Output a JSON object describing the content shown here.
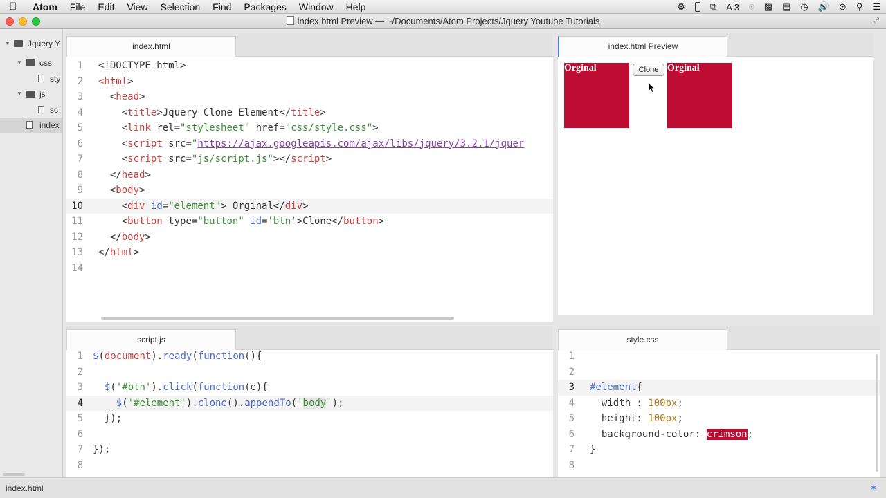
{
  "menubar": {
    "app": "Atom",
    "items": [
      "File",
      "Edit",
      "View",
      "Selection",
      "Find",
      "Packages",
      "Window",
      "Help"
    ],
    "status_icons": [
      "gear-icon",
      "battery-icon",
      "display-icon",
      "adobe-icon",
      "lock-icon",
      "video-icon",
      "toolbox-icon",
      "time-machine-icon",
      "volume-icon",
      "do-not-disturb-icon",
      "spotlight-search-icon",
      "list-icon"
    ],
    "adobe_count": "3"
  },
  "window": {
    "title": "index.html Preview — ~/Documents/Atom Projects/Jquery Youtube Tutorials"
  },
  "tree": {
    "root": "Jquery Y",
    "items": [
      {
        "label": "css",
        "type": "folder"
      },
      {
        "label": "sty",
        "type": "file"
      },
      {
        "label": "js",
        "type": "folder"
      },
      {
        "label": "sc",
        "type": "file"
      },
      {
        "label": "index",
        "type": "file"
      }
    ]
  },
  "editor_html": {
    "tab": "index.html",
    "current_line": 10,
    "lines": [
      {
        "n": "1",
        "indent": "",
        "parts": [
          [
            "",
            "<!DOCTYPE html>"
          ]
        ]
      },
      {
        "n": "2",
        "indent": "",
        "parts": [
          [
            "t",
            "<html"
          ],
          [
            "",
            ">"
          ]
        ]
      },
      {
        "n": "3",
        "indent": "  ",
        "parts": [
          [
            "",
            "<"
          ],
          [
            "t",
            "head"
          ],
          [
            "",
            ">"
          ]
        ]
      },
      {
        "n": "4",
        "indent": "    ",
        "parts": [
          [
            "",
            "<"
          ],
          [
            "t",
            "title"
          ],
          [
            "",
            ">Jquery Clone Element</"
          ],
          [
            "t",
            "title"
          ],
          [
            "",
            ">"
          ]
        ]
      },
      {
        "n": "5",
        "indent": "    ",
        "parts": [
          [
            "",
            "<"
          ],
          [
            "t",
            "link"
          ],
          [
            "",
            " "
          ],
          [
            "",
            "rel="
          ],
          [
            "s",
            "\"stylesheet\""
          ],
          [
            "",
            " href="
          ],
          [
            "s",
            "\"css/style.css\""
          ],
          [
            "",
            ">"
          ]
        ]
      },
      {
        "n": "6",
        "indent": "    ",
        "parts": [
          [
            "",
            "<"
          ],
          [
            "t",
            "script"
          ],
          [
            "",
            " src="
          ],
          [
            "s",
            "\""
          ],
          [
            "u",
            "https://ajax.googleapis.com/ajax/libs/jquery/3.2.1/jquer"
          ]
        ]
      },
      {
        "n": "7",
        "indent": "    ",
        "parts": [
          [
            "",
            "<"
          ],
          [
            "t",
            "script"
          ],
          [
            "",
            " src="
          ],
          [
            "s",
            "\"js/script.js\""
          ],
          [
            "",
            "></"
          ],
          [
            "t",
            "script"
          ],
          [
            "",
            ">"
          ]
        ]
      },
      {
        "n": "8",
        "indent": "  ",
        "parts": [
          [
            "",
            "</"
          ],
          [
            "t",
            "head"
          ],
          [
            "",
            ">"
          ]
        ]
      },
      {
        "n": "9",
        "indent": "  ",
        "parts": [
          [
            "",
            "<"
          ],
          [
            "t",
            "body"
          ],
          [
            "",
            ">"
          ]
        ]
      },
      {
        "n": "10",
        "indent": "    ",
        "parts": [
          [
            "",
            "<"
          ],
          [
            "t",
            "div"
          ],
          [
            "",
            " "
          ],
          [
            "a",
            "id"
          ],
          [
            "",
            "="
          ],
          [
            "s",
            "\"element\""
          ],
          [
            "",
            "> Orginal</"
          ],
          [
            "t",
            "div"
          ],
          [
            "",
            ">"
          ]
        ]
      },
      {
        "n": "11",
        "indent": "    ",
        "parts": [
          [
            "",
            "<"
          ],
          [
            "t",
            "button"
          ],
          [
            "",
            " type="
          ],
          [
            "s",
            "\"button\""
          ],
          [
            "",
            " "
          ],
          [
            "a",
            "id"
          ],
          [
            "",
            "="
          ],
          [
            "s",
            "'btn'"
          ],
          [
            "",
            ">Clone</"
          ],
          [
            "t",
            "button"
          ],
          [
            "",
            ">"
          ]
        ]
      },
      {
        "n": "12",
        "indent": "  ",
        "parts": [
          [
            "",
            "</"
          ],
          [
            "t",
            "body"
          ],
          [
            "",
            ">"
          ]
        ]
      },
      {
        "n": "13",
        "indent": "",
        "parts": [
          [
            "",
            "</"
          ],
          [
            "t",
            "html"
          ],
          [
            "",
            ">"
          ]
        ]
      },
      {
        "n": "14",
        "indent": "",
        "parts": []
      }
    ]
  },
  "editor_js": {
    "tab": "script.js",
    "current_line": 4,
    "lines": [
      {
        "n": "1",
        "indent": "",
        "parts": [
          [
            "f",
            "$"
          ],
          [
            "",
            "("
          ],
          [
            "t",
            "document"
          ],
          [
            "",
            ")."
          ],
          [
            "f",
            "ready"
          ],
          [
            "",
            "("
          ],
          [
            "f",
            "function"
          ],
          [
            "",
            "(){"
          ]
        ]
      },
      {
        "n": "2",
        "indent": "",
        "parts": []
      },
      {
        "n": "3",
        "indent": "  ",
        "parts": [
          [
            "f",
            "$"
          ],
          [
            "",
            "("
          ],
          [
            "s",
            "'#btn'"
          ],
          [
            "",
            ")."
          ],
          [
            "f",
            "click"
          ],
          [
            "",
            "("
          ],
          [
            "f",
            "function"
          ],
          [
            "",
            "(e){"
          ]
        ]
      },
      {
        "n": "4",
        "indent": "    ",
        "parts": [
          [
            "f",
            "$"
          ],
          [
            "",
            "("
          ],
          [
            "s",
            "'#element'"
          ],
          [
            "",
            ")."
          ],
          [
            "f",
            "clone"
          ],
          [
            "",
            "()."
          ],
          [
            "f",
            "appendTo"
          ],
          [
            "",
            "("
          ],
          [
            "s",
            "'"
          ],
          [
            "sh",
            "body"
          ],
          [
            "s",
            "'"
          ],
          [
            "",
            ");"
          ]
        ]
      },
      {
        "n": "5",
        "indent": "  ",
        "parts": [
          [
            "",
            "});"
          ]
        ]
      },
      {
        "n": "6",
        "indent": "",
        "parts": []
      },
      {
        "n": "7",
        "indent": "",
        "parts": [
          [
            "",
            "});"
          ]
        ]
      },
      {
        "n": "8",
        "indent": "",
        "parts": []
      }
    ]
  },
  "editor_css": {
    "tab": "style.css",
    "current_line": 3,
    "lines": [
      {
        "n": "1",
        "indent": "",
        "parts": []
      },
      {
        "n": "2",
        "indent": "",
        "parts": []
      },
      {
        "n": "3",
        "indent": "",
        "parts": [
          [
            "a",
            "#element"
          ],
          [
            "",
            "{"
          ]
        ]
      },
      {
        "n": "4",
        "indent": "  ",
        "parts": [
          [
            "",
            "width : "
          ],
          [
            "n",
            "100px"
          ],
          [
            "",
            ";"
          ]
        ]
      },
      {
        "n": "5",
        "indent": "  ",
        "parts": [
          [
            "",
            "height: "
          ],
          [
            "n",
            "100px"
          ],
          [
            "",
            ";"
          ]
        ]
      },
      {
        "n": "6",
        "indent": "  ",
        "parts": [
          [
            "",
            "background-color: "
          ],
          [
            "cr",
            "crimson"
          ],
          [
            "",
            ";"
          ]
        ]
      },
      {
        "n": "7",
        "indent": "",
        "parts": [
          [
            "",
            "}"
          ]
        ]
      },
      {
        "n": "8",
        "indent": "",
        "parts": []
      }
    ]
  },
  "preview": {
    "tab": "index.html Preview",
    "box_label": "Orginal",
    "box_color": "#be0d33",
    "button_label": "Clone",
    "boxes": [
      "Orginal",
      "Orginal"
    ]
  },
  "statusbar": {
    "file": "index.html",
    "icon": "squirrel-icon"
  },
  "colors": {
    "tag": "#c8423f",
    "attr": "#4b6ec9",
    "string": "#3f8f3a",
    "crimson": "#be0d33"
  }
}
